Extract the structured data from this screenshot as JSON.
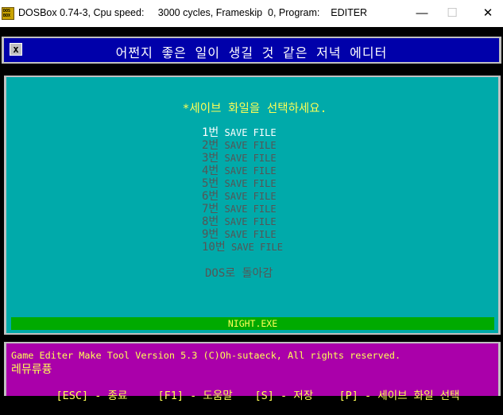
{
  "window": {
    "icon_line1": "DOS",
    "icon_line2": "BOX",
    "title": "DOSBox 0.74-3, Cpu speed:     3000 cycles, Frameskip  0, Program:    EDITER",
    "minimize": "—",
    "maximize": "☐",
    "close": "✕"
  },
  "header": {
    "close_box": "x",
    "title": "어쩐지 좋은 일이 생길 것 같은 저녁 에디터"
  },
  "main": {
    "prompt": "*세이브 화일을 선택하세요.",
    "save_files": [
      {
        "num": "1번",
        "label": " SAVE FILE"
      },
      {
        "num": "2번",
        "label": " SAVE FILE"
      },
      {
        "num": "3번",
        "label": " SAVE FILE"
      },
      {
        "num": "4번",
        "label": " SAVE FILE"
      },
      {
        "num": "5번",
        "label": " SAVE FILE"
      },
      {
        "num": "6번",
        "label": " SAVE FILE"
      },
      {
        "num": "7번",
        "label": " SAVE FILE"
      },
      {
        "num": "8번",
        "label": " SAVE FILE"
      },
      {
        "num": "9번",
        "label": " SAVE FILE"
      },
      {
        "num": "10번",
        "label": " SAVE FILE"
      }
    ],
    "selected_index": 0,
    "dos_return": "DOS로 돌아감",
    "status": "NIGHT.EXE"
  },
  "footer": {
    "line1": "Game Editer Make Tool Version 5.3 (C)Oh-sutaeck, All rights reserved.",
    "line2": "레뮤류퓽",
    "keys": [
      "[ESC] - 종료",
      "[F1] - 도움말",
      "[S] - 저장",
      "[P] - 세이브 화일 선택"
    ]
  },
  "colors": {
    "header_bg": "#0000aa",
    "main_bg": "#00aaaa",
    "prompt": "#ffff55",
    "status_bg": "#00aa00",
    "footer_bg": "#aa00aa"
  }
}
